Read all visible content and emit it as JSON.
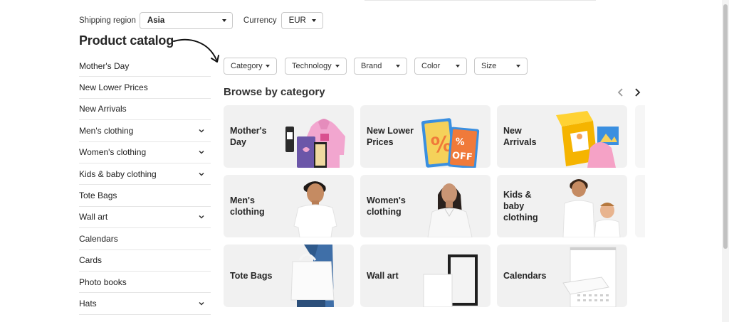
{
  "header": {
    "shipping_label": "Shipping region",
    "shipping_value": "Asia",
    "currency_label": "Currency",
    "currency_value": "EUR"
  },
  "title": "Product catalog",
  "sidebar": {
    "items": [
      {
        "label": "Mother's Day",
        "expandable": false
      },
      {
        "label": "New Lower Prices",
        "expandable": false
      },
      {
        "label": "New Arrivals",
        "expandable": false
      },
      {
        "label": "Men's clothing",
        "expandable": true
      },
      {
        "label": "Women's clothing",
        "expandable": true
      },
      {
        "label": "Kids & baby clothing",
        "expandable": true
      },
      {
        "label": "Tote Bags",
        "expandable": false
      },
      {
        "label": "Wall art",
        "expandable": true
      },
      {
        "label": "Calendars",
        "expandable": false
      },
      {
        "label": "Cards",
        "expandable": false
      },
      {
        "label": "Photo books",
        "expandable": false
      },
      {
        "label": "Hats",
        "expandable": true
      }
    ]
  },
  "filters": [
    "Category",
    "Technology",
    "Brand",
    "Color",
    "Size"
  ],
  "browse": {
    "title": "Browse by category",
    "cards": [
      {
        "label": "Mother's Day"
      },
      {
        "label": "New Lower Prices"
      },
      {
        "label": "New Arrivals"
      },
      {
        "label": "Men's clothing"
      },
      {
        "label": "Women's clothing"
      },
      {
        "label": "Kids & baby clothing"
      },
      {
        "label": "Tote Bags"
      },
      {
        "label": "Wall art"
      },
      {
        "label": "Calendars"
      }
    ]
  },
  "colors": {
    "card_bg": "#f1f1f1",
    "hoodie_pink": "#f2a6cf",
    "sale_blue": "#3a8fe0",
    "sale_orange": "#f07a3a",
    "box_yellow": "#f5b400"
  },
  "icons": {
    "annotation": "curved-arrow-icon",
    "carousel_prev": "chevron-left-icon",
    "carousel_next": "chevron-right-icon",
    "expand": "chevron-down-icon"
  }
}
